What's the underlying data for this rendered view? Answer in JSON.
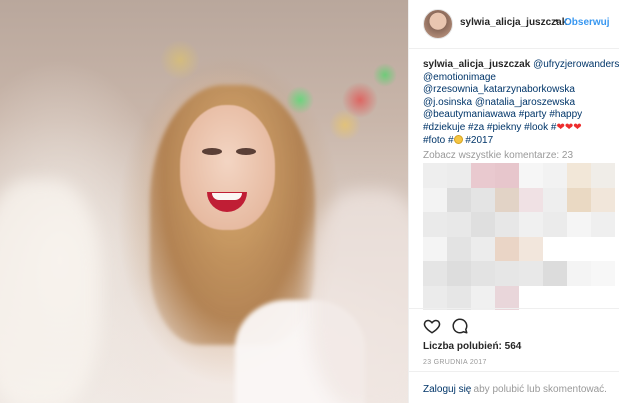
{
  "post": {
    "username": "sylwia_alicja_juszczak",
    "separator": "•",
    "follow_label": "Obserwuj",
    "caption_lines": [
      [
        "@ufryzjerowandersa"
      ],
      [
        "@emotionimage"
      ],
      [
        "@rzesownia_katarzynaborkowska"
      ],
      [
        "@j.osinska @natalia_jaroszewska"
      ],
      [
        "@beautymaniawawa #party #happy"
      ],
      [
        "#dziekuje #za #piekny #look #"
      ],
      [
        "#foto #",
        "#2017"
      ]
    ],
    "hearts": [
      "❤",
      "❤",
      "❤"
    ],
    "view_all_comments": "Zobacz wszystkie komentarze: 23",
    "likes": "Liczba polubień: 564",
    "date": "23 GRUDNIA 2017",
    "login_link": "Zaloguj się",
    "login_rest": ", aby polubić lub skomentować."
  },
  "icons": {
    "avatar": "profile-avatar",
    "like": "heart-outline-icon",
    "comment": "comment-bubble-icon",
    "emoji": "smiley-emoji-icon"
  },
  "colors": {
    "link": "#003569",
    "follow": "#3897f0",
    "muted": "#999999",
    "heart": "#ed2d2d"
  },
  "pixelated_comments": [
    "#eeeeee",
    "#ececec",
    "#e9c9cf",
    "#e7c6cc",
    "#f6f6f6",
    "#f2f2f2",
    "#f2e7d8",
    "#f0ede8",
    "#f3f3f3",
    "#dcdcdc",
    "#e4e4e4",
    "#e2d3c6",
    "#f0e1e4",
    "#eeeeee",
    "#ead9c3",
    "#f1e6da",
    "#eaeaea",
    "#e8e8e8",
    "#dfdfdf",
    "#e7e7e7",
    "#f0f0f0",
    "#ebebeb",
    "#f5f5f5",
    "#efefef",
    "#f4f4f4",
    "#e3e3e3",
    "#ececec",
    "#ead5c6",
    "#f2e6dc",
    "#ffffff",
    "#ffffff",
    "#ffffff",
    "#e5e5e5",
    "#dddddd",
    "#e3e3e3",
    "#e6e6e6",
    "#e8e8e8",
    "#dcdcdc",
    "#f4f4f4",
    "#f7f7f7",
    "#ebebeb",
    "#e6e6e6",
    "#f0f0f0",
    "#e9d6da",
    "#ffffff",
    "#ffffff",
    "#ffffff",
    "#ffffff"
  ]
}
